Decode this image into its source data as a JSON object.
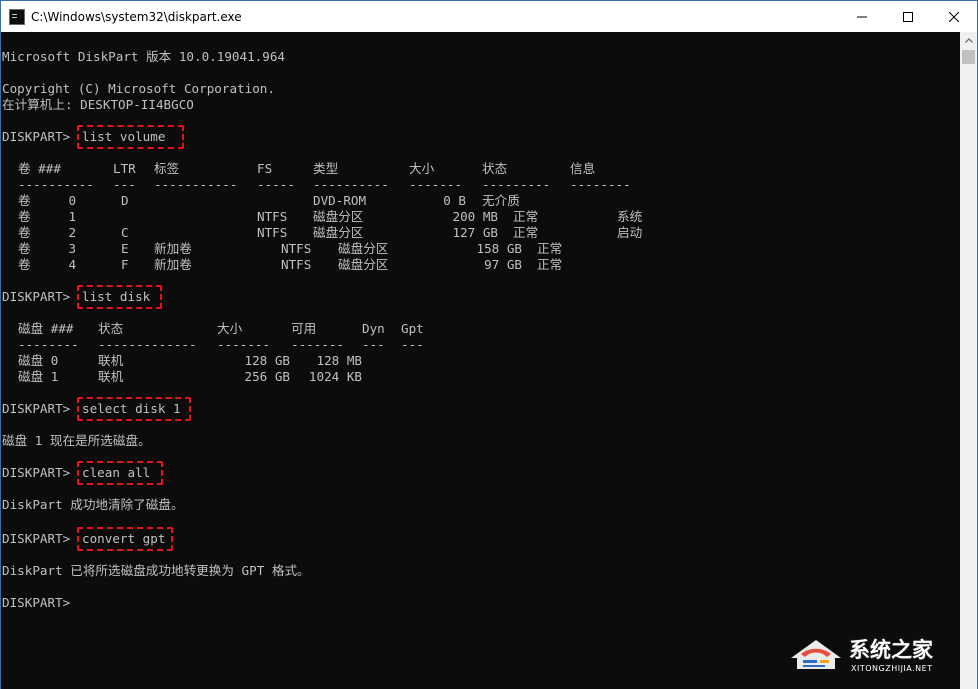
{
  "window": {
    "title": "C:\\Windows\\system32\\diskpart.exe",
    "controls": [
      "minimize",
      "maximize",
      "close"
    ]
  },
  "console": {
    "header": {
      "version": "Microsoft DiskPart 版本 10.0.19041.964",
      "copyright": "Copyright (C) Microsoft Corporation.",
      "computer": "在计算机上: DESKTOP-II4BGCO"
    },
    "prompt": "DISKPART>",
    "commands": {
      "list_volume": "list volume",
      "list_disk": "list disk",
      "select_disk": "select disk 1",
      "clean_all": "clean all",
      "convert_gpt": "convert gpt"
    },
    "volume_table": {
      "headers": {
        "vol": "卷 ###",
        "ltr": "LTR",
        "label": "标签",
        "fs": "FS",
        "type": "类型",
        "size": "大小",
        "status": "状态",
        "info": "信息"
      },
      "separators": {
        "vol": "----------",
        "ltr": "---",
        "label": "-----------",
        "fs": "-----",
        "type": "----------",
        "size": "-------",
        "status": "---------",
        "info": "--------"
      },
      "rows": [
        {
          "vol": "卷     0",
          "ltr": "D",
          "label": "",
          "fs": "",
          "type": "DVD-ROM",
          "size": "0 B",
          "status": "无介质",
          "info": ""
        },
        {
          "vol": "卷     1",
          "ltr": "",
          "label": "",
          "fs": "NTFS",
          "type": "磁盘分区",
          "size": "200 MB",
          "status": "正常",
          "info": "系统"
        },
        {
          "vol": "卷     2",
          "ltr": "C",
          "label": "",
          "fs": "NTFS",
          "type": "磁盘分区",
          "size": "127 GB",
          "status": "正常",
          "info": "启动"
        },
        {
          "vol": "卷     3",
          "ltr": "E",
          "label": "新加卷",
          "fs": "NTFS",
          "type": "磁盘分区",
          "size": "158 GB",
          "status": "正常",
          "info": ""
        },
        {
          "vol": "卷     4",
          "ltr": "F",
          "label": "新加卷",
          "fs": "NTFS",
          "type": "磁盘分区",
          "size": "97 GB",
          "status": "正常",
          "info": ""
        }
      ]
    },
    "disk_table": {
      "headers": {
        "disk": "磁盘 ###",
        "status": "状态",
        "size": "大小",
        "free": "可用",
        "dyn": "Dyn",
        "gpt": "Gpt"
      },
      "separators": {
        "disk": "--------",
        "status": "-------------",
        "size": "-------",
        "free": "-------",
        "dyn": "---",
        "gpt": "---"
      },
      "rows": [
        {
          "disk": "磁盘 0",
          "status": "联机",
          "size": "128 GB",
          "free": "128 MB",
          "dyn": "",
          "gpt": ""
        },
        {
          "disk": "磁盘 1",
          "status": "联机",
          "size": "256 GB",
          "free": "1024 KB",
          "dyn": "",
          "gpt": ""
        }
      ]
    },
    "messages": {
      "select_result": "磁盘 1 现在是所选磁盘。",
      "clean_result": "DiskPart 成功地清除了磁盘。",
      "convert_result": "DiskPart 已将所选磁盘成功地转更换为 GPT 格式。"
    }
  },
  "watermark": {
    "title": "系统之家",
    "subtitle": "XITONGZHIJIA.NET"
  },
  "colors": {
    "console_bg": "#0c0c0c",
    "console_text": "#c0c0c0",
    "highlight_box": "#e0141e",
    "titlebar_bg": "#ffffff"
  }
}
